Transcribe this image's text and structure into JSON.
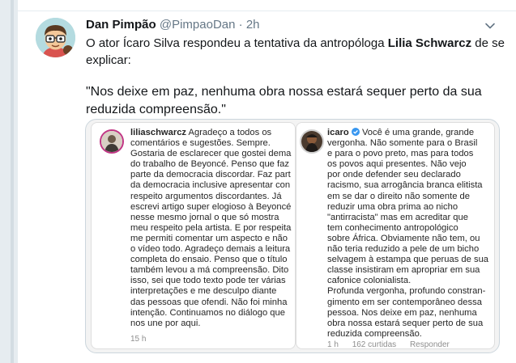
{
  "tweet": {
    "display_name": "Dan Pimpão",
    "handle": "@PimpaoDan",
    "separator": "·",
    "time": "2h",
    "text_prefix": "O ator Ícaro Silva respondeu a tentativa da antropóloga ",
    "text_bold": "Lilia Schwarcz",
    "text_suffix": " de se explicar:",
    "quote": "\"Nos deixe em paz, nenhuma obra nossa estará sequer perto da sua reduzida compreensão.\""
  },
  "screenshot_left": {
    "username": "liliaschwarcz",
    "text": " Agradeço a todos os\ncomentários e sugestões. Sempre.\nGostaria de esclarecer que gostei dema\ndo trabalho de Beyoncé. Penso que faz\nparte da democracia discordar. Faz part\nda democracia inclusive apresentar con\nrespeito argumentos discordantes. Já\nescrevi artigo super elogioso à Beyoncé\nnesse mesmo jornal o que só mostra\nmeu respeito pela artista. E por respeita\nme permiti comentar um aspecto e não\no vídeo todo. Agradeço demais a leitura\ncompleta do ensaio. Penso que o título\ntambém levou a má compreensão. Dito\nisso, sei que todo  texto pode ter várias\ninterpretações e me desculpo diante\ndas pessoas que ofendi. Não foi minha\nintenção. Continuamos no diálogo que\nnos une por aqui.",
    "time": "15 h"
  },
  "screenshot_right": {
    "username": "icaro",
    "verified_icon": "verified-badge-icon",
    "text": " Você é uma grande, grande\nvergonha. Não somente para o Brasil\ne para o povo preto, mas para todos\nos povos aqui presentes. Não vejo\npor onde defender seu declarado\nracismo, sua arrogância branca elitista\nem se dar o direito não somente de\nreduzir uma obra prima ao nicho\n\"antirracista\" mas em acreditar que\ntem conhecimento antropológico\nsobre África. Obviamente não tem, ou\nnão teria reduzido a pele de um bicho\nselvagem à estampa que peruas de sua\nclasse insistiram em apropriar em sua\ncafonice colonialista.\nProfunda vergonha, profundo constran-\ngimento em ser contemporâneo dessa\npessoa. Nos deixe em paz, nenhuma\nobra nossa estará sequer perto de sua\nreduzida compreensão.",
    "time": "1 h",
    "likes": "162 curtidas",
    "reply": "Responder"
  },
  "colors": {
    "text": "#14171a",
    "muted": "#657786",
    "border": "#e6ecf0",
    "instagram_ring": "#c13584"
  }
}
